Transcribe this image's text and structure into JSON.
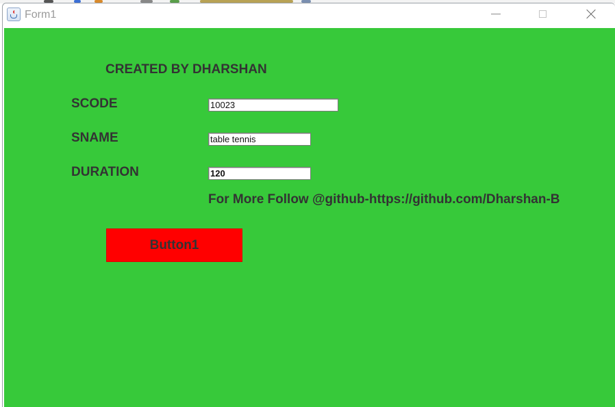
{
  "window": {
    "title": "Form1"
  },
  "form": {
    "credit_text": "CREATED BY DHARSHAN",
    "scode_label": "SCODE",
    "scode_value": "10023",
    "sname_label": "SNAME",
    "sname_value": "table tennis",
    "duration_label": "DURATION",
    "duration_value": "120",
    "follow_text": "For More Follow @github-https://github.com/Dharshan-B",
    "button_label": "Button1"
  },
  "icons": {
    "app_icon": "java-cup-icon",
    "minimize": "minimize-icon",
    "maximize": "maximize-icon",
    "close": "close-icon"
  },
  "colors": {
    "form_background": "#37c93a",
    "button_background": "#ff0000",
    "label_text": "#333333"
  }
}
